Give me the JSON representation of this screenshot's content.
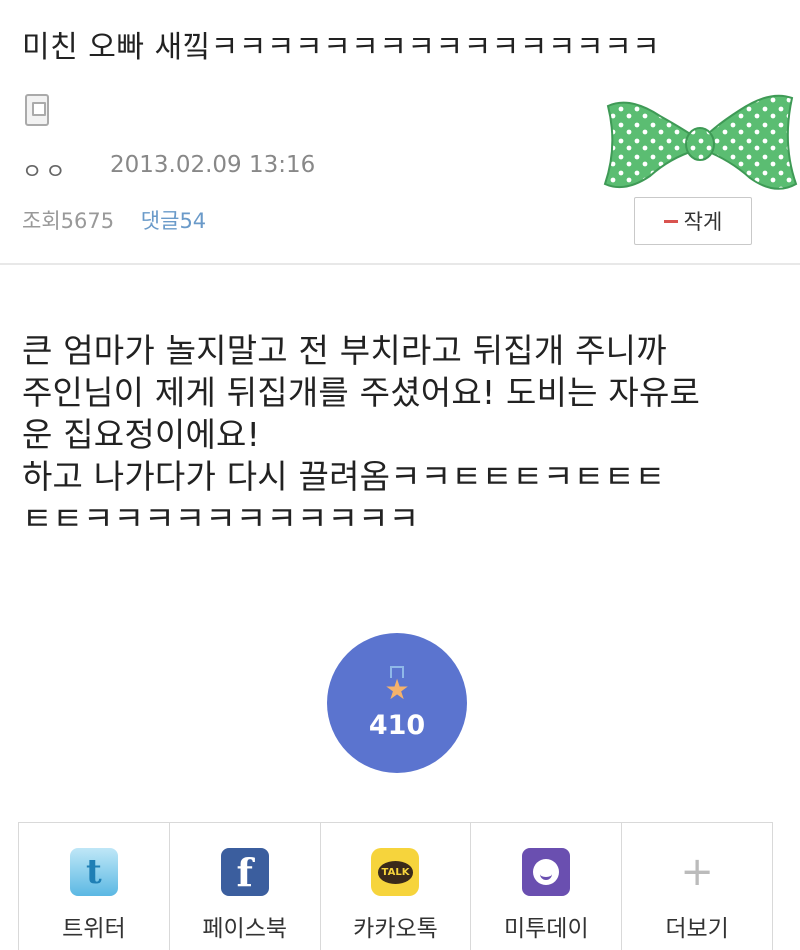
{
  "post": {
    "title": "미친 오빠 새낔ㅋㅋㅋㅋㅋㅋㅋㅋㅋㅋㅋㅋㅋㅋㅋㅋ",
    "author": "ㅇㅇ",
    "date": "2013.02.09 13:16",
    "views_label": "조회",
    "views": "5675",
    "comments_label": "댓글",
    "comments": "54",
    "write_button": "작게",
    "body_lines": [
      "큰 엄마가 놀지말고 전 부치라고 뒤집개 주니까",
      "주인님이 제게 뒤집개를 주셨어요! 도비는 자유로",
      "운 집요정이에요!",
      "하고 나가다가 다시 끌려옴ㅋㅋㅌㅌㅌㅋㅌㅌㅌ",
      "ㅌㅌㅋㅋㅋㅋㅋㅋㅋㅋㅋㅋㅋ"
    ]
  },
  "recommend": {
    "count": "410",
    "icon": "star-medal-icon"
  },
  "share": {
    "items": [
      {
        "label": "트위터",
        "icon": "twitter-icon"
      },
      {
        "label": "페이스북",
        "icon": "facebook-icon"
      },
      {
        "label": "카카오톡",
        "icon": "kakaotalk-icon"
      },
      {
        "label": "미투데이",
        "icon": "me2day-icon"
      },
      {
        "label": "더보기",
        "icon": "plus-icon"
      }
    ]
  },
  "colors": {
    "recommend_bg": "#5b74cf",
    "comments": "#6a9ac9",
    "bowtie": "#5bbd72"
  }
}
